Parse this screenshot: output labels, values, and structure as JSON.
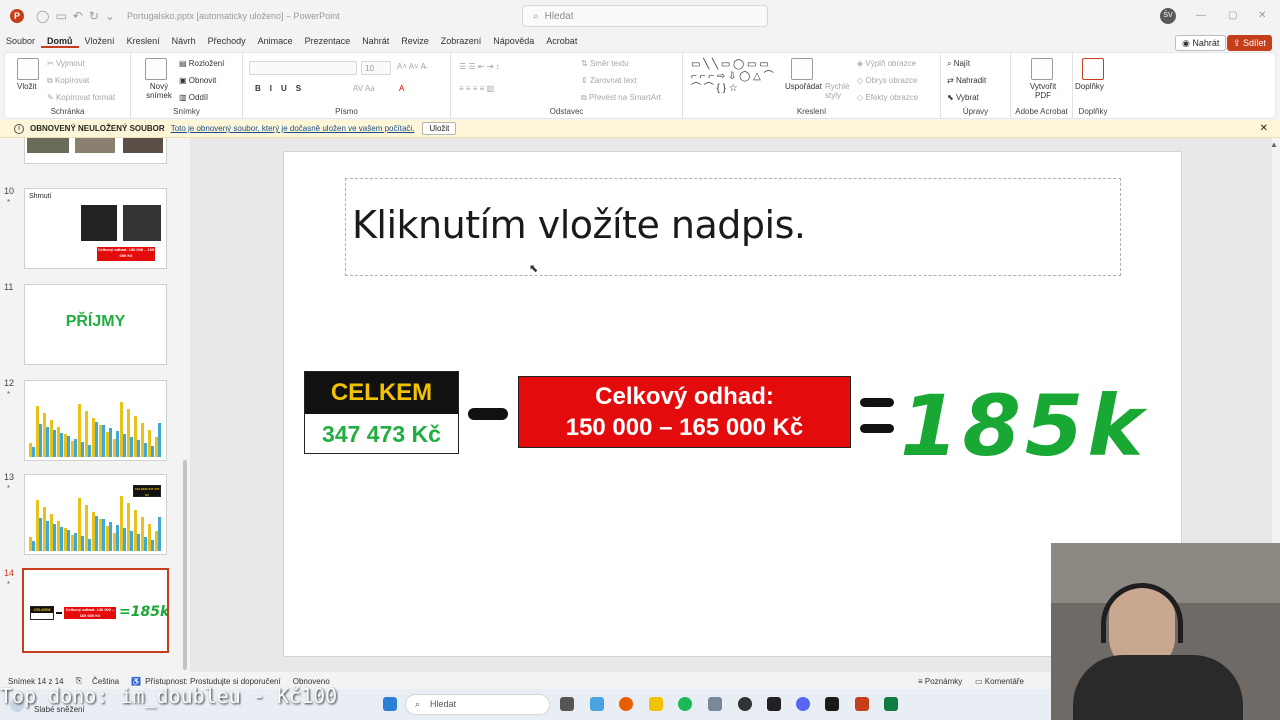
{
  "titlebar": {
    "app_icon": "P",
    "doc_title": "Portugalsko.pptx [automaticky uloženo] – PowerPoint",
    "search_placeholder": "Hledat",
    "avatar_initials": "ŠV"
  },
  "menu": {
    "tabs": [
      "Soubor",
      "Domů",
      "Vložení",
      "Kreslení",
      "Návrh",
      "Přechody",
      "Animace",
      "Prezentace",
      "Nahrát",
      "Revize",
      "Zobrazení",
      "Nápověda",
      "Acrobat"
    ],
    "active_tab": "Domů",
    "record_button": "Nahrát",
    "share_button": "Sdílet"
  },
  "ribbon": {
    "groups": {
      "clipboard": "Schránka",
      "slides": "Snímky",
      "font": "Písmo",
      "paragraph": "Odstavec",
      "drawing": "Kreslení",
      "editing": "Úpravy",
      "acrobat": "Adobe Acrobat",
      "addins": "Doplňky"
    },
    "paste": "Vložit",
    "cut": "Vyjmout",
    "copy": "Kopírovat",
    "format_painter": "Kopírovat formát",
    "new_slide": "Nový snímek",
    "layout": "Rozložení",
    "reset": "Obnovit",
    "section": "Oddíl",
    "font_size": "10",
    "text_direction": "Směr textu",
    "align_text": "Zarovnat text",
    "smartart": "Převést na SmartArt",
    "arrange": "Uspořádat",
    "quick_styles": "Rychlé styly",
    "shape_fill": "Výplň obrazce",
    "shape_outline": "Obrys obrazce",
    "shape_effects": "Efekty obrazce",
    "find": "Najít",
    "replace": "Nahradit",
    "select": "Vybrat",
    "create_pdf": "Vytvořit PDF",
    "addins": "Doplňky",
    "font_buttons": [
      "B",
      "I",
      "U",
      "S"
    ]
  },
  "notification": {
    "title": "OBNOVENÝ NEULOŽENÝ SOUBOR",
    "message": "Toto je obnovený soubor, který je dočasně uložen ve vašem počítači.",
    "save_button": "Uložit"
  },
  "thumbnails": [
    {
      "number": "10",
      "heading": "Shrnutí",
      "label": "Celkový odhad: 150 000 – 165 000 Kč"
    },
    {
      "number": "11",
      "heading": "PŘÍJMY"
    },
    {
      "number": "12"
    },
    {
      "number": "13",
      "label": "CELKEM 347 473 Kč"
    },
    {
      "number": "14",
      "selected": true,
      "celkem": "CELKEM",
      "odhad": "Celkový odhad: 150 000 – 165 000 Kč",
      "result": "185k"
    }
  ],
  "slide": {
    "title_placeholder": "Kliknutím vložíte nadpis.",
    "celkem_label": "CELKEM",
    "celkem_value": "347 473 Kč",
    "odhad_line1": "Celkový odhad:",
    "odhad_line2": "150 000 – 165 000 Kč",
    "result": "185k",
    "colors": {
      "green": "#1aa835",
      "red": "#e30b0b",
      "yellow": "#f2c200"
    }
  },
  "status": {
    "slide_count": "Snímek 14 z 14",
    "language": "Čeština",
    "accessibility": "Přístupnost: Prostudujte si doporučení",
    "recovered": "Obnoveno",
    "notes": "Poznámky",
    "comments": "Komentáře"
  },
  "taskbar": {
    "search": "Hledat",
    "weather": "Slabé sněžení"
  },
  "overlay": {
    "donation_text": "Top dono: im_doubleu - Kč100"
  }
}
